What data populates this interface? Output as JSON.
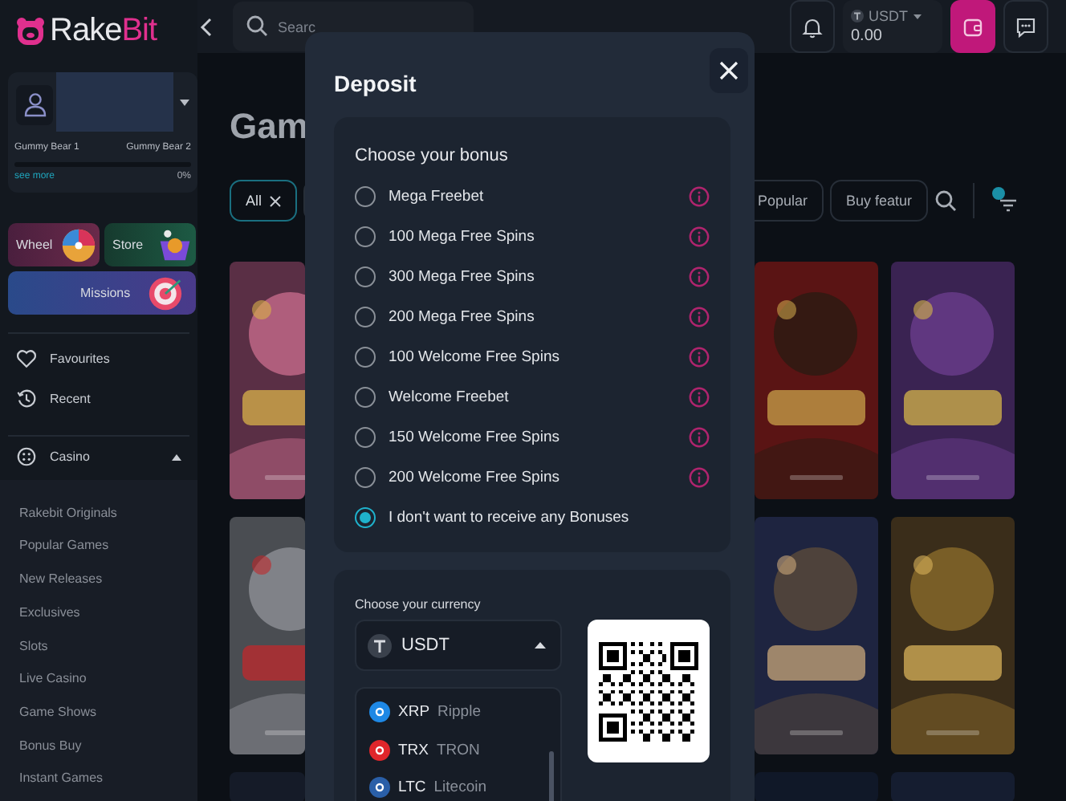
{
  "sidebar": {
    "logo": {
      "first": "Rake",
      "second": "Bit"
    },
    "user": {
      "tier_left": "Gummy Bear 1",
      "tier_right": "Gummy Bear 2",
      "level": 0,
      "link": "see more",
      "percent": "0%"
    },
    "promos": [
      {
        "label": "Wheel",
        "kind": "wheel"
      },
      {
        "label": "Store",
        "kind": "store"
      },
      {
        "label": "Missions",
        "kind": "missions"
      }
    ],
    "nav": [
      {
        "label": "Favourites",
        "kind": "heart"
      },
      {
        "label": "Recent",
        "kind": "clock"
      },
      {
        "label": "Casino",
        "kind": "dice",
        "expanded": true,
        "children": [
          {
            "label": "Rakebit Originals"
          },
          {
            "label": "Popular Games"
          },
          {
            "label": "New Releases"
          },
          {
            "label": "Exclusives"
          },
          {
            "label": "Slots"
          },
          {
            "label": "Live Casino"
          },
          {
            "label": "Game Shows"
          },
          {
            "label": "Bonus Buy"
          },
          {
            "label": "Instant Games"
          }
        ]
      }
    ]
  },
  "topbar": {
    "search": {
      "placeholder": "Searc"
    },
    "balance": {
      "currency": "USDT",
      "amount": "0.00"
    }
  },
  "main": {
    "heading": "Gam",
    "filters": [
      {
        "label": "All",
        "selected": true
      },
      {
        "label": "Popular",
        "selected": false
      },
      {
        "label": "Buy featur",
        "selected": false
      }
    ]
  },
  "modal": {
    "title": "Deposit",
    "bonus": {
      "heading": "Choose your bonus",
      "options": [
        {
          "label": "Mega Freebet",
          "selected": false,
          "info": true
        },
        {
          "label": "100 Mega Free Spins",
          "selected": false,
          "info": true
        },
        {
          "label": "300 Mega Free Spins",
          "selected": false,
          "info": true
        },
        {
          "label": "200 Mega Free Spins",
          "selected": false,
          "info": true
        },
        {
          "label": "100 Welcome Free Spins",
          "selected": false,
          "info": true
        },
        {
          "label": "Welcome Freebet",
          "selected": false,
          "info": true
        },
        {
          "label": "150 Welcome Free Spins",
          "selected": false,
          "info": true
        },
        {
          "label": "200 Welcome Free Spins",
          "selected": false,
          "info": true
        },
        {
          "label": "I don't want to receive any Bonuses",
          "selected": true,
          "info": false
        }
      ]
    },
    "currency": {
      "heading": "Choose your currency",
      "selected": "USDT",
      "expanded": true,
      "options": [
        {
          "code": "XRP",
          "name": "Ripple",
          "color": "#1e88e5"
        },
        {
          "code": "TRX",
          "name": "TRON",
          "color": "#e0262b"
        },
        {
          "code": "LTC",
          "name": "Litecoin",
          "color": "#2a5fa8"
        }
      ]
    }
  }
}
